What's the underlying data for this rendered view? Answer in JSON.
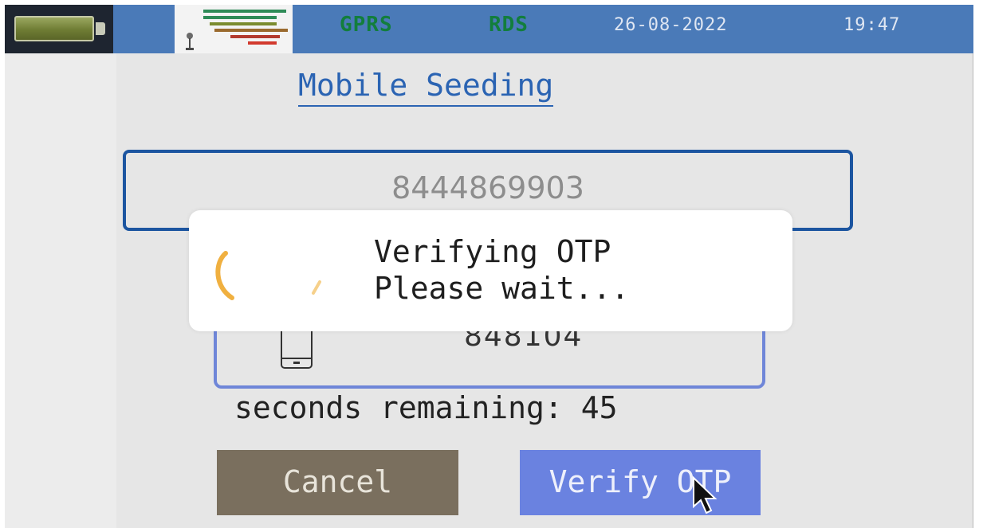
{
  "status_bar": {
    "gprs": "GPRS",
    "rds": "RDS",
    "date": "26-08-2022",
    "time": "19:47"
  },
  "page": {
    "title": "Mobile Seeding"
  },
  "mobile": {
    "value": "8444869903"
  },
  "otp": {
    "value": "848104"
  },
  "timer": {
    "label": "seconds remaining:",
    "seconds": "45"
  },
  "buttons": {
    "cancel": "Cancel",
    "verify": "Verify OTP"
  },
  "dialog": {
    "line1": "Verifying OTP",
    "line2": "Please wait..."
  },
  "icons": {
    "battery": "battery-icon",
    "signal": "signal-strength-icon",
    "phone": "phone-icon",
    "spinner": "loading-spinner-icon",
    "cursor": "mouse-pointer-icon"
  },
  "colors": {
    "status_bar": "#4a7ab8",
    "status_green": "#127e3c",
    "title_blue": "#2b64b3",
    "cancel_button": "#7a6f5e",
    "verify_button": "#6a82e0"
  }
}
